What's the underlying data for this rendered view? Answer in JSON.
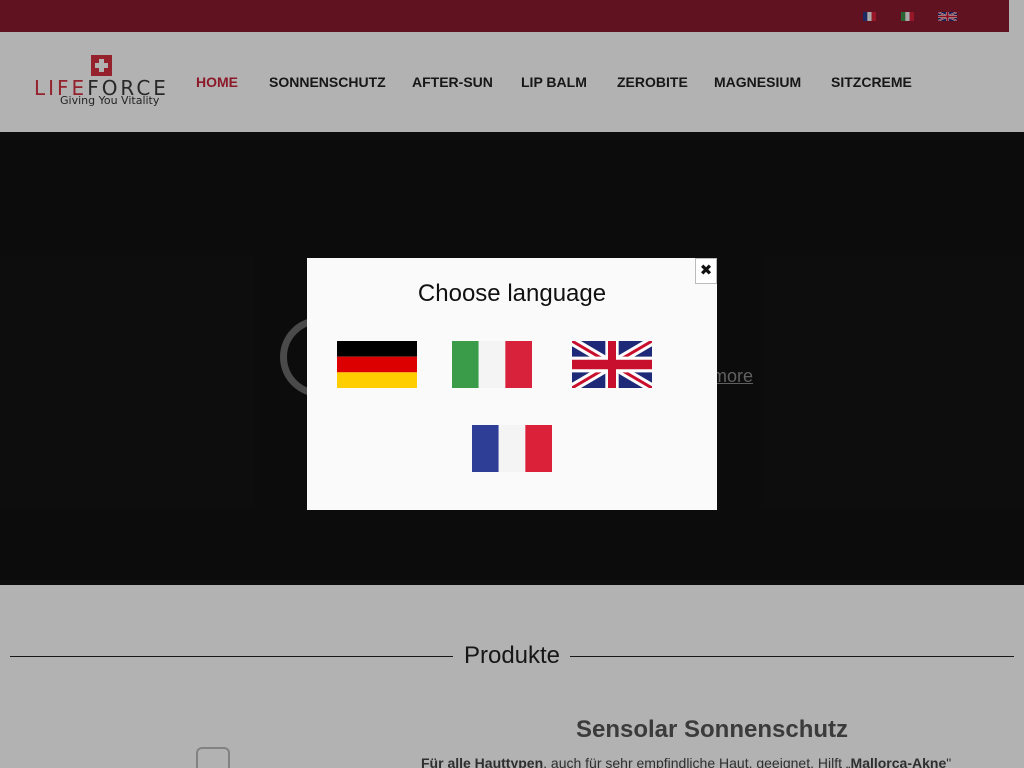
{
  "brand": {
    "logo_word_part1": "LIFE",
    "logo_word_part2": "FORCE",
    "tagline": "Giving You Vitality",
    "accent_color": "#8b1a30",
    "nav_active_color": "#c9253d"
  },
  "nav": {
    "items": [
      {
        "label": "HOME",
        "active": true
      },
      {
        "label": "SONNENSCHUTZ",
        "active": false
      },
      {
        "label": "AFTER-SUN",
        "active": false
      },
      {
        "label": "LIP BALM",
        "active": false
      },
      {
        "label": "ZEROBITE",
        "active": false
      },
      {
        "label": "MAGNESIUM",
        "active": false
      },
      {
        "label": "SITZCREME",
        "active": false
      }
    ]
  },
  "topbar": {
    "flags": [
      "fr-flag-icon",
      "it-flag-icon",
      "gb-flag-icon"
    ]
  },
  "hero": {
    "more_link": "more"
  },
  "products": {
    "section_title": "Produkte",
    "item_name": "Sensolar Sonnenschutz",
    "item_desc_bold": "Für alle Hauttypen",
    "item_desc": ", auch für sehr empfindliche Haut, geeignet. Hilft „",
    "item_desc_bold2": "Mallorca-Akne",
    "item_desc_end": "\""
  },
  "modal": {
    "title": "Choose language",
    "close_icon": "close-icon",
    "options": [
      "de-flag-icon",
      "it-flag-icon",
      "gb-flag-icon",
      "fr-flag-icon"
    ]
  }
}
